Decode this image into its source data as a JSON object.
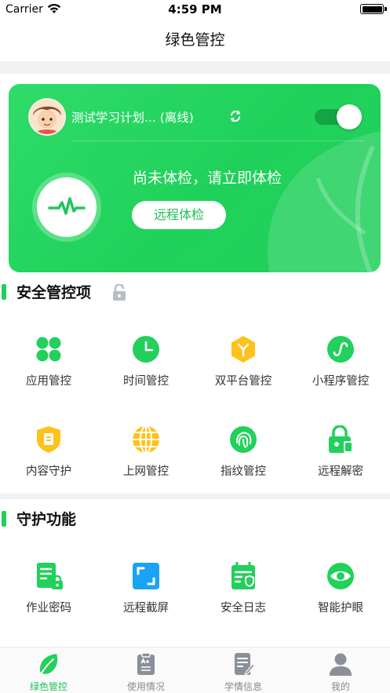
{
  "status_bar": {
    "carrier": "Carrier",
    "time": "4:59 PM"
  },
  "nav": {
    "title": "绿色管控"
  },
  "hero": {
    "device_name": "测试学习计划... (离线)",
    "message": "尚未体检，请立即体检",
    "button_label": "远程体检",
    "toggle_on": true
  },
  "security_section": {
    "title": "安全管控项",
    "items": [
      {
        "label": "应用管控",
        "icon": "app-grid-icon"
      },
      {
        "label": "时间管控",
        "icon": "clock-icon"
      },
      {
        "label": "双平台管控",
        "icon": "dual-platform-icon"
      },
      {
        "label": "小程序管控",
        "icon": "mini-program-icon"
      },
      {
        "label": "内容守护",
        "icon": "content-shield-icon"
      },
      {
        "label": "上网管控",
        "icon": "globe-icon"
      },
      {
        "label": "指纹管控",
        "icon": "fingerprint-icon"
      },
      {
        "label": "远程解密",
        "icon": "unlock-icon"
      }
    ]
  },
  "guard_section": {
    "title": "守护功能",
    "items": [
      {
        "label": "作业密码",
        "icon": "homework-lock-icon"
      },
      {
        "label": "远程截屏",
        "icon": "screenshot-icon"
      },
      {
        "label": "安全日志",
        "icon": "security-log-icon"
      },
      {
        "label": "智能护眼",
        "icon": "eye-icon"
      }
    ]
  },
  "tabbar": {
    "tabs": [
      {
        "label": "绿色管控",
        "icon": "leaf-icon",
        "active": true
      },
      {
        "label": "使用情况",
        "icon": "clipboard-icon",
        "active": false
      },
      {
        "label": "学情信息",
        "icon": "document-edit-icon",
        "active": false
      },
      {
        "label": "我的",
        "icon": "user-icon",
        "active": false
      }
    ]
  },
  "colors": {
    "accent": "#1fd15a",
    "accent_dark": "#14a443",
    "yellow": "#ffcc00",
    "blue": "#1aa3f5",
    "gray_icon": "#8a8f99"
  }
}
